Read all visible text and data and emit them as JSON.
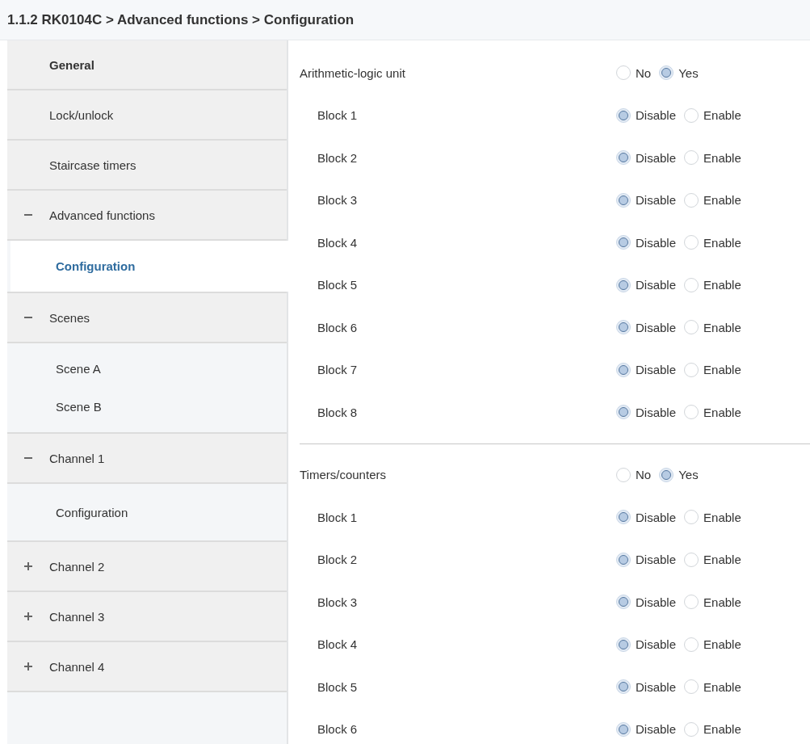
{
  "header": {
    "title": "1.1.2 RK0104C > Advanced functions > Configuration"
  },
  "sidebar": {
    "items": [
      {
        "label": "General",
        "selected": false
      },
      {
        "label": "Lock/unlock",
        "selected": false
      },
      {
        "label": "Staircase timers",
        "selected": false
      },
      {
        "label": "Advanced functions",
        "selected": false,
        "expanded": true,
        "children": [
          {
            "label": "Configuration",
            "selected": true
          }
        ]
      },
      {
        "label": "Scenes",
        "selected": false,
        "expanded": true,
        "children": [
          {
            "label": "Scene A",
            "selected": false
          },
          {
            "label": "Scene B",
            "selected": false
          }
        ]
      },
      {
        "label": "Channel 1",
        "selected": false,
        "expanded": true,
        "children": [
          {
            "label": "Configuration",
            "selected": false
          }
        ]
      },
      {
        "label": "Channel 2",
        "selected": false,
        "expanded": false
      },
      {
        "label": "Channel 3",
        "selected": false,
        "expanded": false
      },
      {
        "label": "Channel 4",
        "selected": false,
        "expanded": false
      }
    ]
  },
  "sections": [
    {
      "label": "Arithmetic-logic unit",
      "options": [
        {
          "label": "No",
          "selected": false
        },
        {
          "label": "Yes",
          "selected": true
        }
      ],
      "blocks": [
        {
          "label": "Block 1",
          "options": [
            {
              "label": "Disable",
              "selected": true
            },
            {
              "label": "Enable",
              "selected": false
            }
          ]
        },
        {
          "label": "Block 2",
          "options": [
            {
              "label": "Disable",
              "selected": true
            },
            {
              "label": "Enable",
              "selected": false
            }
          ]
        },
        {
          "label": "Block 3",
          "options": [
            {
              "label": "Disable",
              "selected": true
            },
            {
              "label": "Enable",
              "selected": false
            }
          ]
        },
        {
          "label": "Block 4",
          "options": [
            {
              "label": "Disable",
              "selected": true
            },
            {
              "label": "Enable",
              "selected": false
            }
          ]
        },
        {
          "label": "Block 5",
          "options": [
            {
              "label": "Disable",
              "selected": true
            },
            {
              "label": "Enable",
              "selected": false
            }
          ]
        },
        {
          "label": "Block 6",
          "options": [
            {
              "label": "Disable",
              "selected": true
            },
            {
              "label": "Enable",
              "selected": false
            }
          ]
        },
        {
          "label": "Block 7",
          "options": [
            {
              "label": "Disable",
              "selected": true
            },
            {
              "label": "Enable",
              "selected": false
            }
          ]
        },
        {
          "label": "Block 8",
          "options": [
            {
              "label": "Disable",
              "selected": true
            },
            {
              "label": "Enable",
              "selected": false
            }
          ]
        }
      ]
    },
    {
      "label": "Timers/counters",
      "options": [
        {
          "label": "No",
          "selected": false
        },
        {
          "label": "Yes",
          "selected": true
        }
      ],
      "blocks": [
        {
          "label": "Block 1",
          "options": [
            {
              "label": "Disable",
              "selected": true
            },
            {
              "label": "Enable",
              "selected": false
            }
          ]
        },
        {
          "label": "Block 2",
          "options": [
            {
              "label": "Disable",
              "selected": true
            },
            {
              "label": "Enable",
              "selected": false
            }
          ]
        },
        {
          "label": "Block 3",
          "options": [
            {
              "label": "Disable",
              "selected": true
            },
            {
              "label": "Enable",
              "selected": false
            }
          ]
        },
        {
          "label": "Block 4",
          "options": [
            {
              "label": "Disable",
              "selected": true
            },
            {
              "label": "Enable",
              "selected": false
            }
          ]
        },
        {
          "label": "Block 5",
          "options": [
            {
              "label": "Disable",
              "selected": true
            },
            {
              "label": "Enable",
              "selected": false
            }
          ]
        },
        {
          "label": "Block 6",
          "options": [
            {
              "label": "Disable",
              "selected": true
            },
            {
              "label": "Enable",
              "selected": false
            }
          ]
        }
      ]
    }
  ]
}
